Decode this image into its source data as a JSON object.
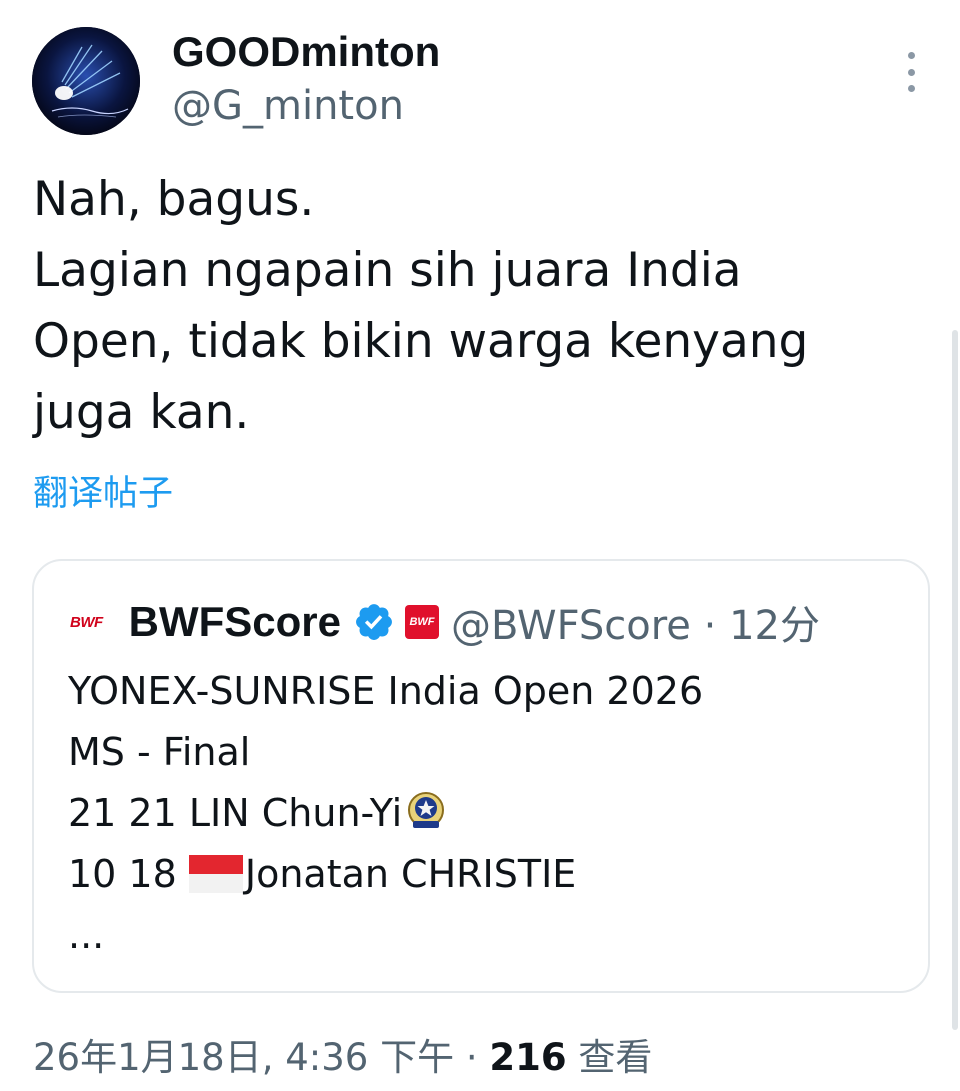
{
  "author": {
    "display_name": "GOODminton",
    "handle": "@G_minton",
    "avatar_icon": "badminton-shuttlecock-avatar-icon"
  },
  "tweet": {
    "text": "Nah, bagus.\nLagian ngapain sih juara India\nOpen, tidak bikin warga kenyang\njuga kan.",
    "translate_label": "翻译帖子"
  },
  "quoted_tweet": {
    "logo_text": "BWF",
    "display_name": "BWFScore",
    "verified_icon": "verified-badge-icon",
    "badge_text": "BWF",
    "handle_time": "@BWFScore · 12分",
    "lines": {
      "title": "YONEX-SUNRISE India Open 2026",
      "event": "MS - Final",
      "player1": "21 21 LIN Chun-Yi",
      "player2_scores": "10 18 ",
      "player2_name": "Jonatan CHRISTIE",
      "ellipsis": "..."
    },
    "player1_icon": "team-emblem-icon",
    "player2_icon": "indonesia-flag-icon"
  },
  "footer": {
    "timestamp": "26年1月18日, 4:36 下午",
    "separator": " · ",
    "views_count": "216",
    "views_label": " 查看"
  },
  "colors": {
    "link_blue": "#1d9bf0",
    "secondary_text": "#536471",
    "primary_text": "#0f1419",
    "bwf_red": "#e0102c",
    "card_border": "#e5e9ec"
  }
}
